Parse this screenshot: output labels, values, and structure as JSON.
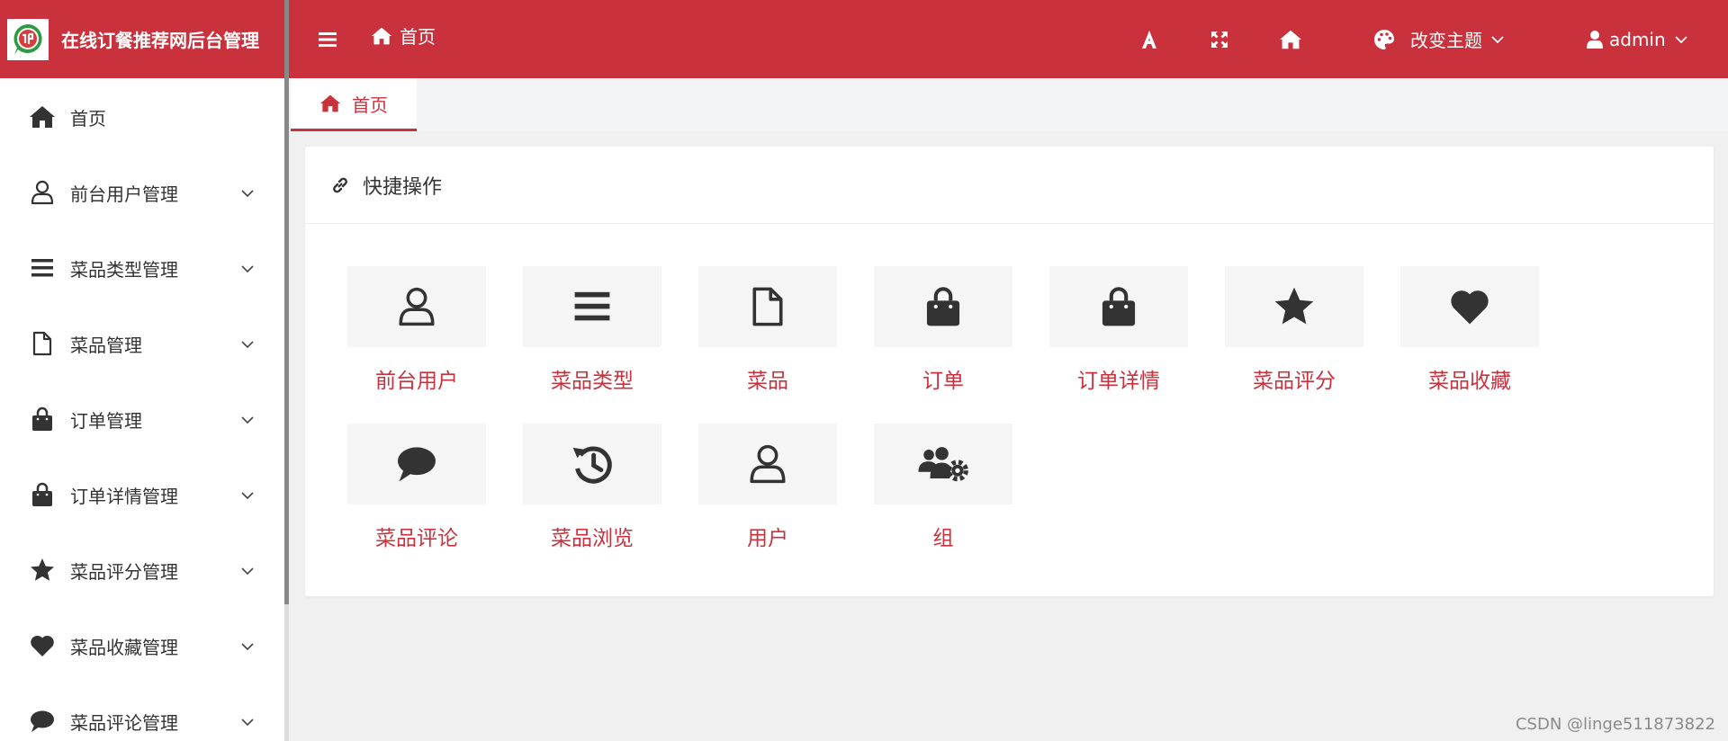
{
  "app": {
    "title": "在线订餐推荐网后台管理"
  },
  "sidebar": {
    "items": [
      {
        "label": "首页",
        "icon": "home-icon",
        "has_children": false
      },
      {
        "label": "前台用户管理",
        "icon": "user-icon",
        "has_children": true
      },
      {
        "label": "菜品类型管理",
        "icon": "list-icon",
        "has_children": true
      },
      {
        "label": "菜品管理",
        "icon": "file-icon",
        "has_children": true
      },
      {
        "label": "订单管理",
        "icon": "shopping-bag-icon",
        "has_children": true
      },
      {
        "label": "订单详情管理",
        "icon": "shopping-bag-icon",
        "has_children": true
      },
      {
        "label": "菜品评分管理",
        "icon": "star-icon",
        "has_children": true
      },
      {
        "label": "菜品收藏管理",
        "icon": "heart-icon",
        "has_children": true
      },
      {
        "label": "菜品评论管理",
        "icon": "comment-icon",
        "has_children": true
      }
    ]
  },
  "topbar": {
    "breadcrumb": "首页",
    "theme_label": "改变主题",
    "user_label": "admin"
  },
  "tabs": [
    {
      "label": "首页",
      "active": true
    }
  ],
  "quick_actions": {
    "title": "快捷操作",
    "items": [
      {
        "label": "前台用户",
        "icon": "user-icon"
      },
      {
        "label": "菜品类型",
        "icon": "list-icon"
      },
      {
        "label": "菜品",
        "icon": "file-icon"
      },
      {
        "label": "订单",
        "icon": "shopping-bag-icon"
      },
      {
        "label": "订单详情",
        "icon": "shopping-bag-icon"
      },
      {
        "label": "菜品评分",
        "icon": "star-icon"
      },
      {
        "label": "菜品收藏",
        "icon": "heart-icon"
      },
      {
        "label": "菜品评论",
        "icon": "comment-icon"
      },
      {
        "label": "菜品浏览",
        "icon": "history-icon"
      },
      {
        "label": "用户",
        "icon": "user-icon"
      },
      {
        "label": "组",
        "icon": "users-gear-icon"
      }
    ]
  },
  "watermark": "CSDN @linge511873822",
  "colors": {
    "primary": "#c9313d",
    "icon": "#333333",
    "tile_bg": "#f5f5f5",
    "page_bg": "#f0f0f0"
  }
}
